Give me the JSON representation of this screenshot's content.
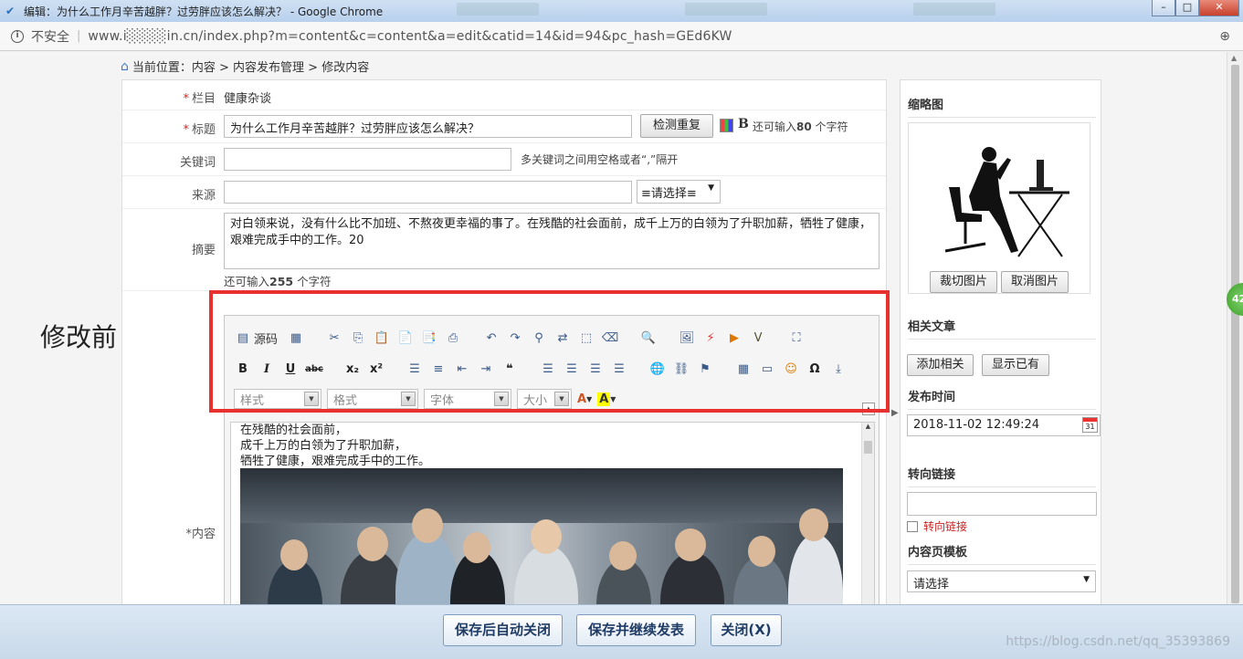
{
  "window": {
    "title": "编辑：为什么工作月辛苦越胖？过劳胖应该怎么解决？ - Google Chrome",
    "controls": {
      "minimize": "–",
      "maximize": "□",
      "close": "✕"
    }
  },
  "address_bar": {
    "security": "不安全",
    "url": "www.i░░░░in.cn/index.php?m=content&c=content&a=edit&catid=14&id=94&pc_hash=GEd6KW"
  },
  "breadcrumb": "当前位置：内容 > 内容发布管理 > 修改内容",
  "side_label": "修改前",
  "form": {
    "category": {
      "label": "栏目",
      "value": "健康杂谈"
    },
    "title": {
      "label": "标题",
      "value": "为什么工作月辛苦越胖？过劳胖应该怎么解决？",
      "check_button": "检测重复",
      "bold_button": "B",
      "remaining_prefix": "还可输入",
      "remaining_count": "80",
      "remaining_suffix": "个字符"
    },
    "keywords": {
      "label": "关键词",
      "value": "",
      "hint": "多关键词之间用空格或者“,”隔开"
    },
    "source": {
      "label": "来源",
      "value": "",
      "select": "≡请选择≡"
    },
    "summary": {
      "label": "摘要",
      "value": "对白领来说，没有什么比不加班、不熬夜更幸福的事了。在残酷的社会面前，成千上万的白领为了升职加薪，牺牲了健康，艰难完成手中的工作。20",
      "remaining_prefix": "还可输入",
      "remaining_count": "255",
      "remaining_suffix": "个字符"
    },
    "content": {
      "label": "内容",
      "toolbar": {
        "source_label": "源码",
        "style_combo": "样式",
        "format_combo": "格式",
        "font_combo": "字体",
        "size_combo": "大小",
        "text_color": "A",
        "bg_color": "A"
      },
      "body_lines": [
        "在残酷的社会面前，",
        "成千上万的白领为了升职加薪，",
        "牺牲了健康，艰难完成手中的工作。"
      ]
    }
  },
  "right_panel": {
    "thumbnail": {
      "title": "缩略图",
      "crop_button": "裁切图片",
      "cancel_button": "取消图片"
    },
    "related": {
      "title": "相关文章",
      "add_button": "添加相关",
      "show_button": "显示已有"
    },
    "publish_time": {
      "title": "发布时间",
      "value": "2018-11-02 12:49:24",
      "calendar": "31"
    },
    "redirect": {
      "title": "转向链接",
      "value": "",
      "checkbox_label": "转向链接"
    },
    "template": {
      "title": "内容页模板",
      "select": "请选择"
    }
  },
  "bottom": {
    "save_close": "保存后自动关闭",
    "save_continue": "保存并继续发表",
    "close": "关闭(X)",
    "watermark": "https://blog.csdn.net/qq_35393869"
  },
  "badge": "42",
  "colors": {
    "highlight": "#e8312f",
    "required": "#dd2222",
    "redirect_label": "#cc2222"
  }
}
